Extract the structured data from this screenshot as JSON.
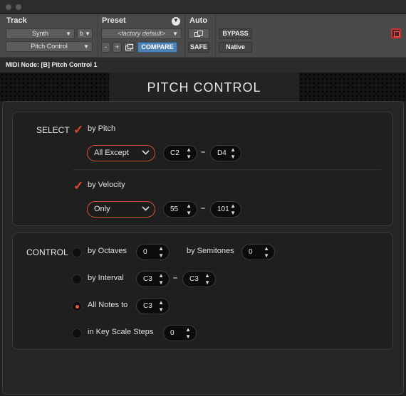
{
  "header": {
    "track_label": "Track",
    "preset_label": "Preset",
    "auto_label": "Auto",
    "track_name": "Synth",
    "track_channel": "b",
    "insert_name": "Pitch Control",
    "preset_name": "<factory default>",
    "minus_label": "-",
    "plus_label": "+",
    "compare_label": "COMPARE",
    "bypass_label": "BYPASS",
    "safe_label": "SAFE",
    "native_label": "Native"
  },
  "midi_node": "MIDI Node: [B] Pitch Control 1",
  "plugin_title": "PITCH CONTROL",
  "select": {
    "label": "SELECT",
    "by_pitch_label": "by Pitch",
    "pitch_mode": "All Except",
    "pitch_low": "C2",
    "pitch_high": "D4",
    "by_velocity_label": "by Velocity",
    "velocity_mode": "Only",
    "velocity_low": "55",
    "velocity_high": "101",
    "dash": "–"
  },
  "control": {
    "label": "CONTROL",
    "by_octaves_label": "by Octaves",
    "octaves_value": "0",
    "by_semitones_label": "by Semitones",
    "semitones_value": "0",
    "by_interval_label": "by Interval",
    "interval_from": "C3",
    "interval_to": "C3",
    "all_notes_label": "All Notes to",
    "all_notes_value": "C3",
    "key_scale_label": "in Key Scale Steps",
    "key_scale_value": "0",
    "selected_option": "all-notes-to"
  },
  "icons": {
    "check": "✓",
    "chevron_down": "⌄",
    "stepper": "▲▼",
    "dropdown_triangle": "▼",
    "link": "link-icon"
  },
  "colors": {
    "accent": "#e0482e",
    "compare": "#4f82b5",
    "close": "#d13030"
  }
}
